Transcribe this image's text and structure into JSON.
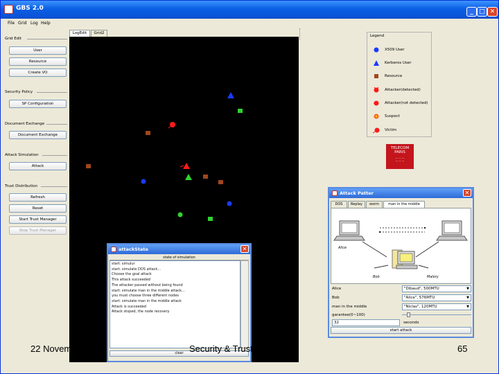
{
  "window": {
    "title": "GBS 2.0"
  },
  "menu": [
    "File",
    "Grid",
    "Log",
    "Help"
  ],
  "left_panel": {
    "groups": [
      {
        "label": "Grid Edit",
        "buttons": [
          {
            "label": "User"
          },
          {
            "label": "Resource"
          },
          {
            "label": "Create VO"
          }
        ]
      },
      {
        "label": "Security Policy",
        "buttons": [
          {
            "label": "SP Configuration"
          }
        ]
      },
      {
        "label": "Document Exchange",
        "buttons": [
          {
            "label": "Document Exchange"
          }
        ]
      },
      {
        "label": "Attack Simulation",
        "buttons": [
          {
            "label": "Attack"
          }
        ]
      },
      {
        "label": "Trust Distribution",
        "buttons": [
          {
            "label": "Refresh"
          },
          {
            "label": "Reset"
          },
          {
            "label": "Start Trust Manager"
          },
          {
            "label": "Stop Trust Manager"
          }
        ]
      }
    ]
  },
  "tabs": [
    "LogEdit",
    "Grid2"
  ],
  "legend": {
    "title": "Legend",
    "items": [
      {
        "label": "X509 User",
        "icon": "blue-circle-icon"
      },
      {
        "label": "Kerberos User",
        "icon": "blue-triangle-icon"
      },
      {
        "label": "Resource",
        "icon": "brown-square-icon"
      },
      {
        "label": "Attacker(detected)",
        "icon": "red-attacker-icon"
      },
      {
        "label": "Attacker(not detected)",
        "icon": "red-attacker-icon"
      },
      {
        "label": "Suspect",
        "icon": "suspect-icon"
      },
      {
        "label": "Victim",
        "icon": "victim-icon"
      }
    ]
  },
  "logo": {
    "title": "TELECOM",
    "subtitle": "PARIS"
  },
  "attack_pattern": {
    "title": "Attack Patter",
    "tabs": [
      "DOS",
      "Replay",
      "worm",
      "man in the middle"
    ],
    "selected_tab": 3,
    "diagram": {
      "labels": [
        "Alice",
        "Bob",
        "Malory"
      ]
    },
    "fields": [
      {
        "label": "Alice",
        "value": "\"Dibaud\", 500MTU"
      },
      {
        "label": "Bob",
        "value": "\"Alice\", 576MTU"
      },
      {
        "label": "man in the middle",
        "value": "\"Niclas\", 120MTU"
      }
    ],
    "guarantee_label": "garantee(0~100)",
    "seconds_value": "32",
    "seconds_unit": "seconds",
    "start_label": "start attack"
  },
  "attack_state": {
    "title": "attackState",
    "header": "state of simulation",
    "lines": [
      "start: simulur",
      "start: simulate DOS attack...",
      "Choose the goal attack",
      "This attack succeeded",
      "The attacker passed without being found",
      "start: simulate man in the middle attack...",
      "you must choose three different nodes",
      "start: simulate man in the middle attack",
      "Attack is succeeded",
      "Attack stoped, the node recovery"
    ],
    "clear_label": "clear"
  },
  "footer": {
    "date": "22 November 2005",
    "title": "Security & Trust in Grid",
    "page": "65"
  },
  "colors": {
    "canvas": "#000000",
    "titlebar": "#0a5fe3",
    "user_blue": "#1a3bff",
    "resource_brown": "#a0461e",
    "kerberos_green": "#2fd32f",
    "attacker_red": "#ff1a1a"
  }
}
